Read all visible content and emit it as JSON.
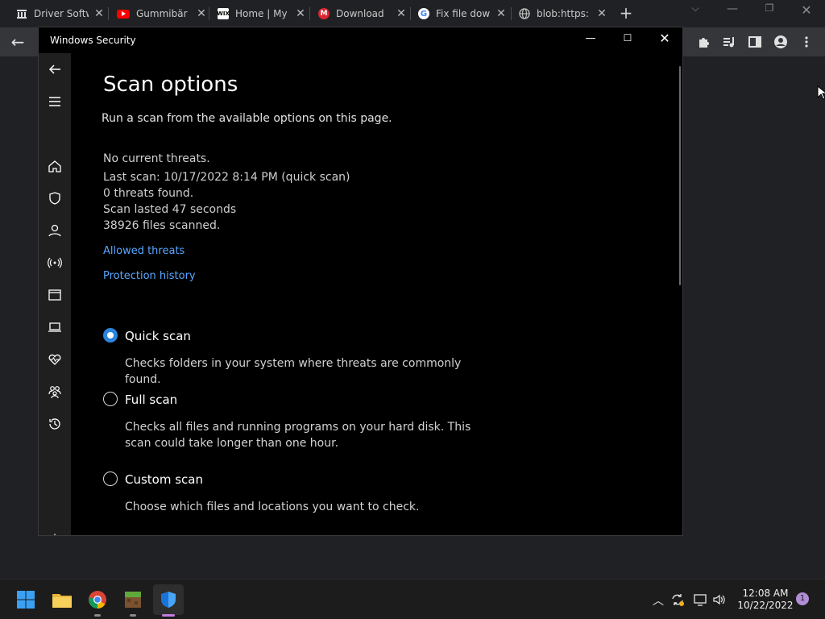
{
  "browser": {
    "tabs": [
      {
        "title": "Driver Softw",
        "icon": "bank-icon"
      },
      {
        "title": "Gummibär",
        "icon": "youtube-icon"
      },
      {
        "title": "Home | My",
        "icon": "wix-icon"
      },
      {
        "title": "Download",
        "icon": "mega-icon"
      },
      {
        "title": "Fix file dow",
        "icon": "google-icon"
      },
      {
        "title": "blob:https:",
        "icon": "globe-icon"
      }
    ]
  },
  "window": {
    "title": "Windows Security"
  },
  "page": {
    "title": "Scan options",
    "subtitle": "Run a scan from the available options on this page.",
    "status": [
      "No current threats.",
      "Last scan: 10/17/2022 8:14 PM (quick scan)",
      "0 threats found.",
      "Scan lasted 47 seconds",
      "38926 files scanned."
    ],
    "links": [
      "Allowed threats",
      "Protection history"
    ],
    "options": [
      {
        "label": "Quick scan",
        "description": "Checks folders in your system where threats are commonly found.",
        "selected": true
      },
      {
        "label": "Full scan",
        "description": "Checks all files and running programs on your hard disk. This scan could take longer than one hour.",
        "selected": false
      },
      {
        "label": "Custom scan",
        "description": "Choose which files and locations you want to check.",
        "selected": false
      }
    ]
  },
  "taskbar": {
    "clock_time": "12:08 AM",
    "clock_date": "10/22/2022",
    "notification_count": "1"
  },
  "colors": {
    "accent": "#2a84de",
    "link": "#5aa6ff"
  }
}
